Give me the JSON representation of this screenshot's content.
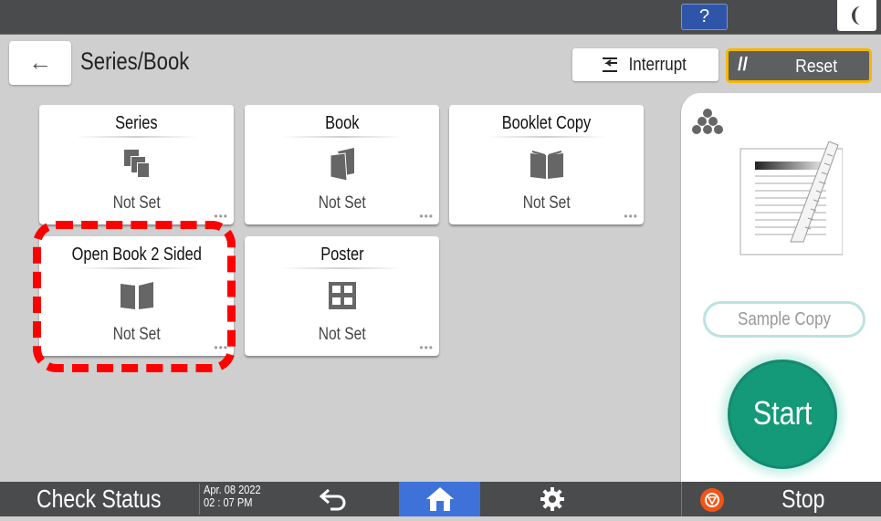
{
  "topbar": {
    "help_icon": "?",
    "sleep_icon": "moon-icon"
  },
  "header": {
    "back_icon": "←",
    "title": "Series/Book",
    "interrupt_label": "Interrupt",
    "reset_label": "Reset"
  },
  "tiles": [
    {
      "title": "Series",
      "status": "Not Set",
      "icon": "series-icon",
      "more": "•••"
    },
    {
      "title": "Book",
      "status": "Not Set",
      "icon": "book-icon",
      "more": "•••"
    },
    {
      "title": "Booklet Copy",
      "status": "Not Set",
      "icon": "booklet-icon",
      "more": "•••"
    },
    {
      "title": "Open Book 2 Sided",
      "status": "Not Set",
      "icon": "open-book-icon",
      "more": "•••"
    },
    {
      "title": "Poster",
      "status": "Not Set",
      "icon": "poster-icon",
      "more": "•••"
    }
  ],
  "right_panel": {
    "sample_copy_label": "Sample Copy",
    "start_label": "Start"
  },
  "bottombar": {
    "check_status_label": "Check Status",
    "date": "Apr. 08 2022",
    "time": "02 : 07 PM",
    "stop_label": "Stop"
  },
  "colors": {
    "accent_blue": "#3f72d8",
    "help_blue": "#2e55a8",
    "reset_border": "#f5b700",
    "start_green": "#149a78",
    "stop_orange": "#f25418",
    "highlight_red": "#ff0000"
  }
}
